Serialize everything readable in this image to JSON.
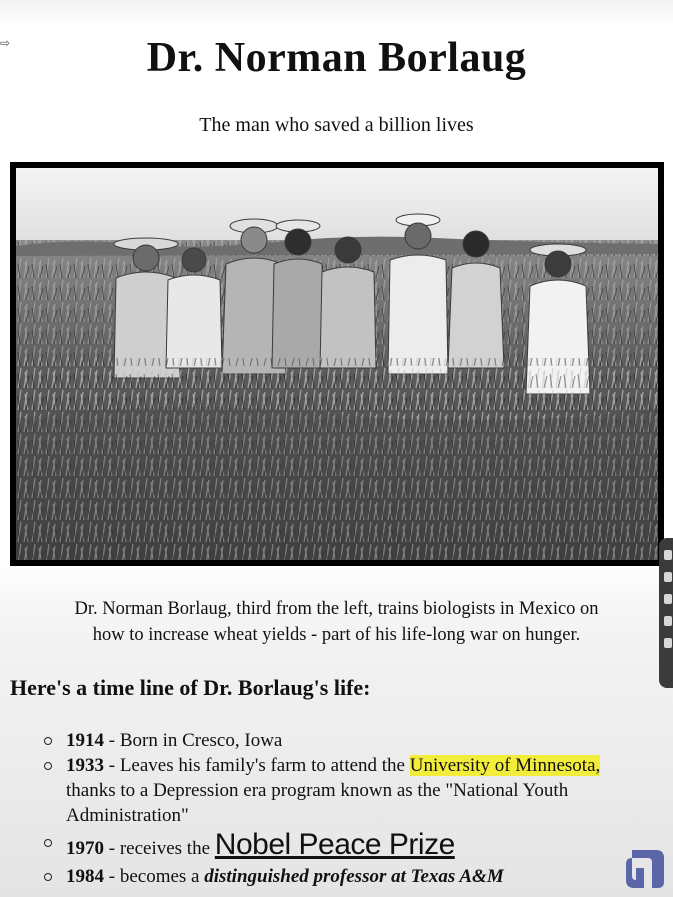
{
  "page": {
    "title": "Dr. Norman Borlaug",
    "subtitle": "The man who saved a billion lives"
  },
  "photo": {
    "description_icon": "photo-image"
  },
  "caption": {
    "line1": "Dr. Norman Borlaug, third from the left, trains biologists in Mexico on",
    "line2": "how to increase wheat yields - part of his life-long war on hunger."
  },
  "timeline": {
    "heading": "Here's a time line of Dr. Borlaug's life:",
    "items": [
      {
        "year": "1914",
        "text": " - Born in Cresco, Iowa"
      },
      {
        "year": "1933",
        "text_before": " - Leaves his family's farm to attend the ",
        "highlight": "University of Minnesota,",
        "text_after": " thanks to a Depression era program known as the \"National Youth Administration\""
      },
      {
        "year": "1970",
        "text_before": " - receives the ",
        "link": "Nobel Peace Prize"
      },
      {
        "year": "1984",
        "text_before": " - becomes a ",
        "emphasis": "distinguished professor at Texas A&M"
      }
    ]
  },
  "colors": {
    "highlight": "#f2ec3a",
    "frame": "#000000",
    "logo": "#5b66a8"
  }
}
